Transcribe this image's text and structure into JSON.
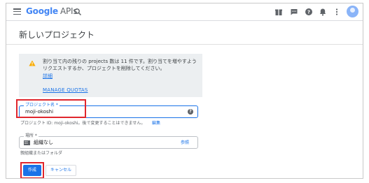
{
  "header": {
    "brand_google": "Google",
    "brand_apis": "APIs",
    "icons": [
      "menu-icon",
      "search-icon",
      "gift-icon",
      "chat-icon",
      "help-icon",
      "notifications-icon",
      "more-vert-icon",
      "avatar"
    ]
  },
  "page": {
    "title": "新しいプロジェクト"
  },
  "quota_notice": {
    "text": "割り当て内の残りの projects 数は 11 件です。割り当てを増やすようリクエストするか、プロジェクトを削除してください。",
    "details_link": "詳細",
    "manage_quotas": "MANAGE QUOTAS"
  },
  "project_name": {
    "label": "プロジェクト名 *",
    "value": "moji-okoshi"
  },
  "project_id": {
    "text": "プロジェクト ID: moji-okoshi。後で変更することはできません。",
    "edit_link": "編集"
  },
  "location": {
    "label": "場所 *",
    "value": "組織なし",
    "browse": "参照",
    "helper": "親組織またはフォルダ"
  },
  "actions": {
    "create": "作成",
    "cancel": "キャンセル"
  },
  "colors": {
    "accent": "#1a73e8",
    "highlight": "#e0262d",
    "warning": "#f9ab00"
  }
}
